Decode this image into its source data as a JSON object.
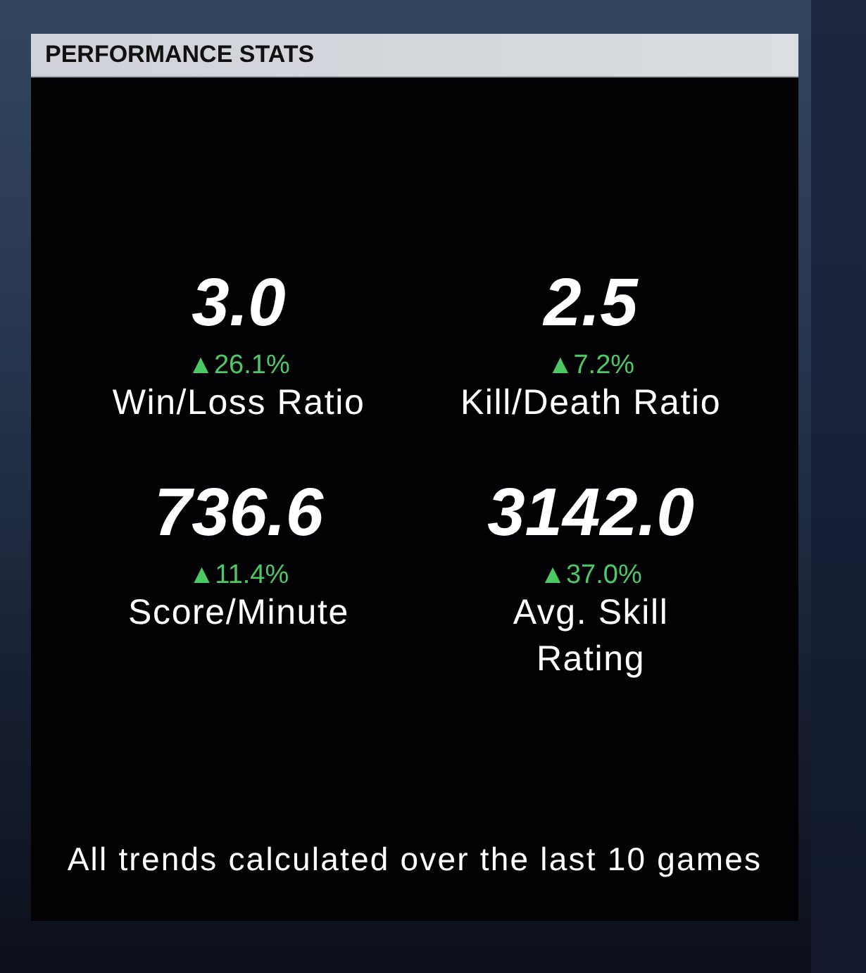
{
  "panel": {
    "title": "PERFORMANCE STATS"
  },
  "stats": [
    {
      "value": "3.0",
      "trend": "▲26.1%",
      "metric": "Win/Loss Ratio"
    },
    {
      "value": "2.5",
      "trend": "▲7.2%",
      "metric": "Kill/Death Ratio"
    },
    {
      "value": "736.6",
      "trend": "▲11.4%",
      "metric": "Score/Minute"
    },
    {
      "value": "3142.0",
      "trend": "▲37.0%",
      "metric": "Avg. Skill Rating"
    }
  ],
  "footnote": "All trends calculated over the last 10 games"
}
